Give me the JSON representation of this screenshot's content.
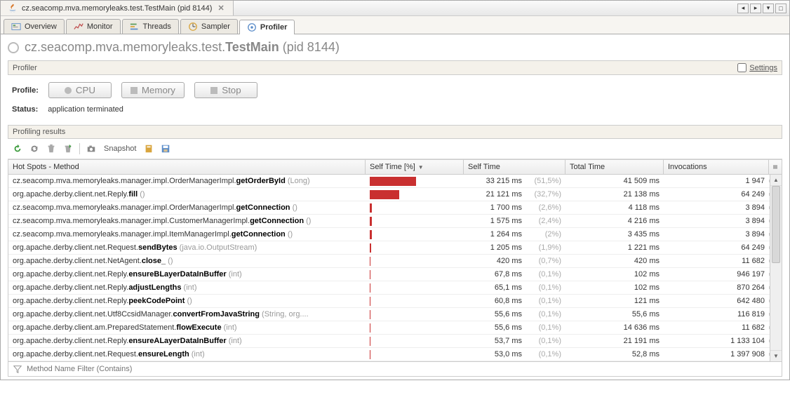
{
  "window": {
    "title": "cz.seacomp.mva.memoryleaks.test.TestMain (pid 8144)"
  },
  "tabs": [
    {
      "label": "Overview"
    },
    {
      "label": "Monitor"
    },
    {
      "label": "Threads"
    },
    {
      "label": "Sampler"
    },
    {
      "label": "Profiler"
    }
  ],
  "page": {
    "title_prefix": "cz.seacomp.mva.memoryleaks.test.",
    "title_bold": "TestMain",
    "title_suffix": " (pid 8144)"
  },
  "profiler_section": {
    "title": "Profiler",
    "settings_label": "Settings"
  },
  "control": {
    "profile_label": "Profile:",
    "cpu_btn": "CPU",
    "memory_btn": "Memory",
    "stop_btn": "Stop",
    "status_label": "Status:",
    "status_value": "application terminated"
  },
  "results_section": {
    "title": "Profiling results",
    "snapshot_label": "Snapshot"
  },
  "columns": {
    "method": "Hot Spots - Method",
    "bar": "Self Time [%]",
    "self": "Self Time",
    "total": "Total Time",
    "inv": "Invocations"
  },
  "filter": {
    "placeholder": "Method Name Filter (Contains)"
  },
  "rows": [
    {
      "pkg": "cz.seacomp.mva.memoryleaks.manager.impl.OrderManagerImpl.",
      "mname": "getOrderById",
      "params": " (Long)",
      "bar": 51.5,
      "self": "33 215 ms",
      "pct": "(51,5%)",
      "total": "41 509 ms",
      "inv": "1 947"
    },
    {
      "pkg": "org.apache.derby.client.net.Reply.",
      "mname": "fill",
      "params": " ()",
      "bar": 32.7,
      "self": "21 121 ms",
      "pct": "(32,7%)",
      "total": "21 138 ms",
      "inv": "64 249"
    },
    {
      "pkg": "cz.seacomp.mva.memoryleaks.manager.impl.OrderManagerImpl.",
      "mname": "getConnection",
      "params": " ()",
      "bar": 2.6,
      "self": "1 700 ms",
      "pct": "(2,6%)",
      "total": "4 118 ms",
      "inv": "3 894"
    },
    {
      "pkg": "cz.seacomp.mva.memoryleaks.manager.impl.CustomerManagerImpl.",
      "mname": "getConnection",
      "params": " ()",
      "bar": 2.4,
      "self": "1 575 ms",
      "pct": "(2,4%)",
      "total": "4 216 ms",
      "inv": "3 894"
    },
    {
      "pkg": "cz.seacomp.mva.memoryleaks.manager.impl.ItemManagerImpl.",
      "mname": "getConnection",
      "params": " ()",
      "bar": 2.0,
      "self": "1 264 ms",
      "pct": "(2%)",
      "total": "3 435 ms",
      "inv": "3 894"
    },
    {
      "pkg": "org.apache.derby.client.net.Request.",
      "mname": "sendBytes",
      "params": " (java.io.OutputStream)",
      "bar": 1.9,
      "self": "1 205 ms",
      "pct": "(1,9%)",
      "total": "1 221 ms",
      "inv": "64 249"
    },
    {
      "pkg": "org.apache.derby.client.net.NetAgent.",
      "mname": "close_",
      "params": " ()",
      "bar": 0.7,
      "self": "420 ms",
      "pct": "(0,7%)",
      "total": "420 ms",
      "inv": "11 682"
    },
    {
      "pkg": "org.apache.derby.client.net.Reply.",
      "mname": "ensureBLayerDataInBuffer",
      "params": " (int)",
      "bar": 0.1,
      "self": "67,8 ms",
      "pct": "(0,1%)",
      "total": "102 ms",
      "inv": "946 197"
    },
    {
      "pkg": "org.apache.derby.client.net.Reply.",
      "mname": "adjustLengths",
      "params": " (int)",
      "bar": 0.1,
      "self": "65,1 ms",
      "pct": "(0,1%)",
      "total": "102 ms",
      "inv": "870 264"
    },
    {
      "pkg": "org.apache.derby.client.net.Reply.",
      "mname": "peekCodePoint",
      "params": " ()",
      "bar": 0.1,
      "self": "60,8 ms",
      "pct": "(0,1%)",
      "total": "121 ms",
      "inv": "642 480"
    },
    {
      "pkg": "org.apache.derby.client.net.Utf8CcsidManager.",
      "mname": "convertFromJavaString",
      "params": " (String, org....",
      "bar": 0.1,
      "self": "55,6 ms",
      "pct": "(0,1%)",
      "total": "55,6 ms",
      "inv": "116 819"
    },
    {
      "pkg": "org.apache.derby.client.am.PreparedStatement.",
      "mname": "flowExecute",
      "params": " (int)",
      "bar": 0.1,
      "self": "55,6 ms",
      "pct": "(0,1%)",
      "total": "14 636 ms",
      "inv": "11 682"
    },
    {
      "pkg": "org.apache.derby.client.net.Reply.",
      "mname": "ensureALayerDataInBuffer",
      "params": " (int)",
      "bar": 0.1,
      "self": "53,7 ms",
      "pct": "(0,1%)",
      "total": "21 191 ms",
      "inv": "1 133 104"
    },
    {
      "pkg": "org.apache.derby.client.net.Request.",
      "mname": "ensureLength",
      "params": " (int)",
      "bar": 0.1,
      "self": "53,0 ms",
      "pct": "(0,1%)",
      "total": "52,8 ms",
      "inv": "1 397 908"
    }
  ]
}
